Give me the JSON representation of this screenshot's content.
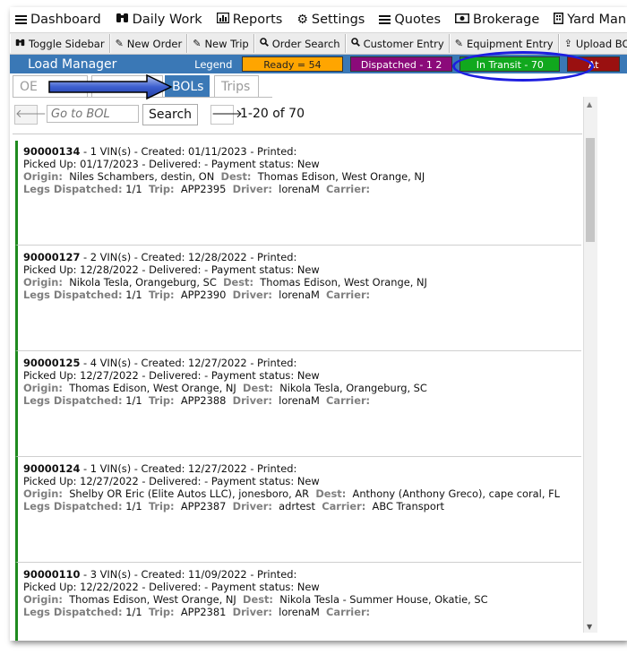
{
  "menu": [
    {
      "label": "Dashboard",
      "icon": "bars-icon"
    },
    {
      "label": "Daily Work",
      "icon": "binoculars-icon"
    },
    {
      "label": "Reports",
      "icon": "bar-chart-icon"
    },
    {
      "label": "Settings",
      "icon": "gear-icon"
    },
    {
      "label": "Quotes",
      "icon": "list-icon"
    },
    {
      "label": "Brokerage",
      "icon": "money-icon"
    },
    {
      "label": "Yard Management",
      "icon": "building-icon"
    }
  ],
  "toolbar": [
    {
      "label": "Toggle Sidebar",
      "icon": "binoculars-icon"
    },
    {
      "label": "New Order",
      "icon": "edit-icon"
    },
    {
      "label": "New Trip",
      "icon": "edit-icon"
    },
    {
      "label": "Order Search",
      "icon": "search-icon"
    },
    {
      "label": "Customer Entry",
      "icon": "search-icon"
    },
    {
      "label": "Equipment Entry",
      "icon": "edit-icon"
    },
    {
      "label": "Upload BOL pdf",
      "icon": "upload-icon"
    }
  ],
  "header": {
    "title": "Load Manager",
    "legend_label": "Legend",
    "ready": "Ready = 54",
    "dispatched": "Dispatched - 1 2",
    "in_transit": "In Transit - 70",
    "at": "At"
  },
  "tabs": [
    "OE",
    "BOLs",
    "Trips"
  ],
  "search": {
    "placeholder": "Go to BOL",
    "button": "Search",
    "page_count": "1-20 of 70"
  },
  "labels": {
    "vins": "VIN(s) - Created:",
    "printed": "- Printed:",
    "picked_up": "Picked Up:",
    "delivered": "- Delivered:",
    "payment": "- Payment status:",
    "origin": "Origin:",
    "dest": "Dest:",
    "legs": "Legs Dispatched:",
    "trip": "Trip:",
    "driver": "Driver:",
    "carrier": "Carrier:"
  },
  "bols": [
    {
      "id": "90000134",
      "vins": "1",
      "created": "01/11/2023",
      "picked_up": "01/17/2023",
      "payment": "New",
      "origin": "Niles Schambers, destin, ON",
      "dest": "Thomas Edison, West Orange, NJ",
      "legs": "1/1",
      "trip": "APP2395",
      "driver": "lorenaM",
      "carrier": ""
    },
    {
      "id": "90000127",
      "vins": "2",
      "created": "12/28/2022",
      "picked_up": "12/28/2022",
      "payment": "New",
      "origin": "Nikola Tesla, Orangeburg, SC",
      "dest": "Thomas Edison, West Orange, NJ",
      "legs": "1/1",
      "trip": "APP2390",
      "driver": "lorenaM",
      "carrier": ""
    },
    {
      "id": "90000125",
      "vins": "4",
      "created": "12/27/2022",
      "picked_up": "12/27/2022",
      "payment": "New",
      "origin": "Thomas Edison, West Orange, NJ",
      "dest": "Nikola Tesla, Orangeburg, SC",
      "legs": "1/1",
      "trip": "APP2388",
      "driver": "lorenaM",
      "carrier": ""
    },
    {
      "id": "90000124",
      "vins": "1",
      "created": "12/27/2022",
      "picked_up": "12/27/2022",
      "payment": "New",
      "origin": "Shelby OR Eric (Elite Autos LLC), jonesboro, AR",
      "dest": "Anthony (Anthony Greco), cape coral, FL",
      "legs": "1/1",
      "trip": "APP2387",
      "driver": "adrtest",
      "carrier": "ABC Transport"
    },
    {
      "id": "90000110",
      "vins": "3",
      "created": "11/09/2022",
      "picked_up": "12/22/2022",
      "payment": "New",
      "origin": "Thomas Edison, West Orange, NJ",
      "dest": "Nikola Tesla - Summer House, Okatie, SC",
      "legs": "1/1",
      "trip": "APP2381",
      "driver": "lorenaM",
      "carrier": ""
    }
  ]
}
